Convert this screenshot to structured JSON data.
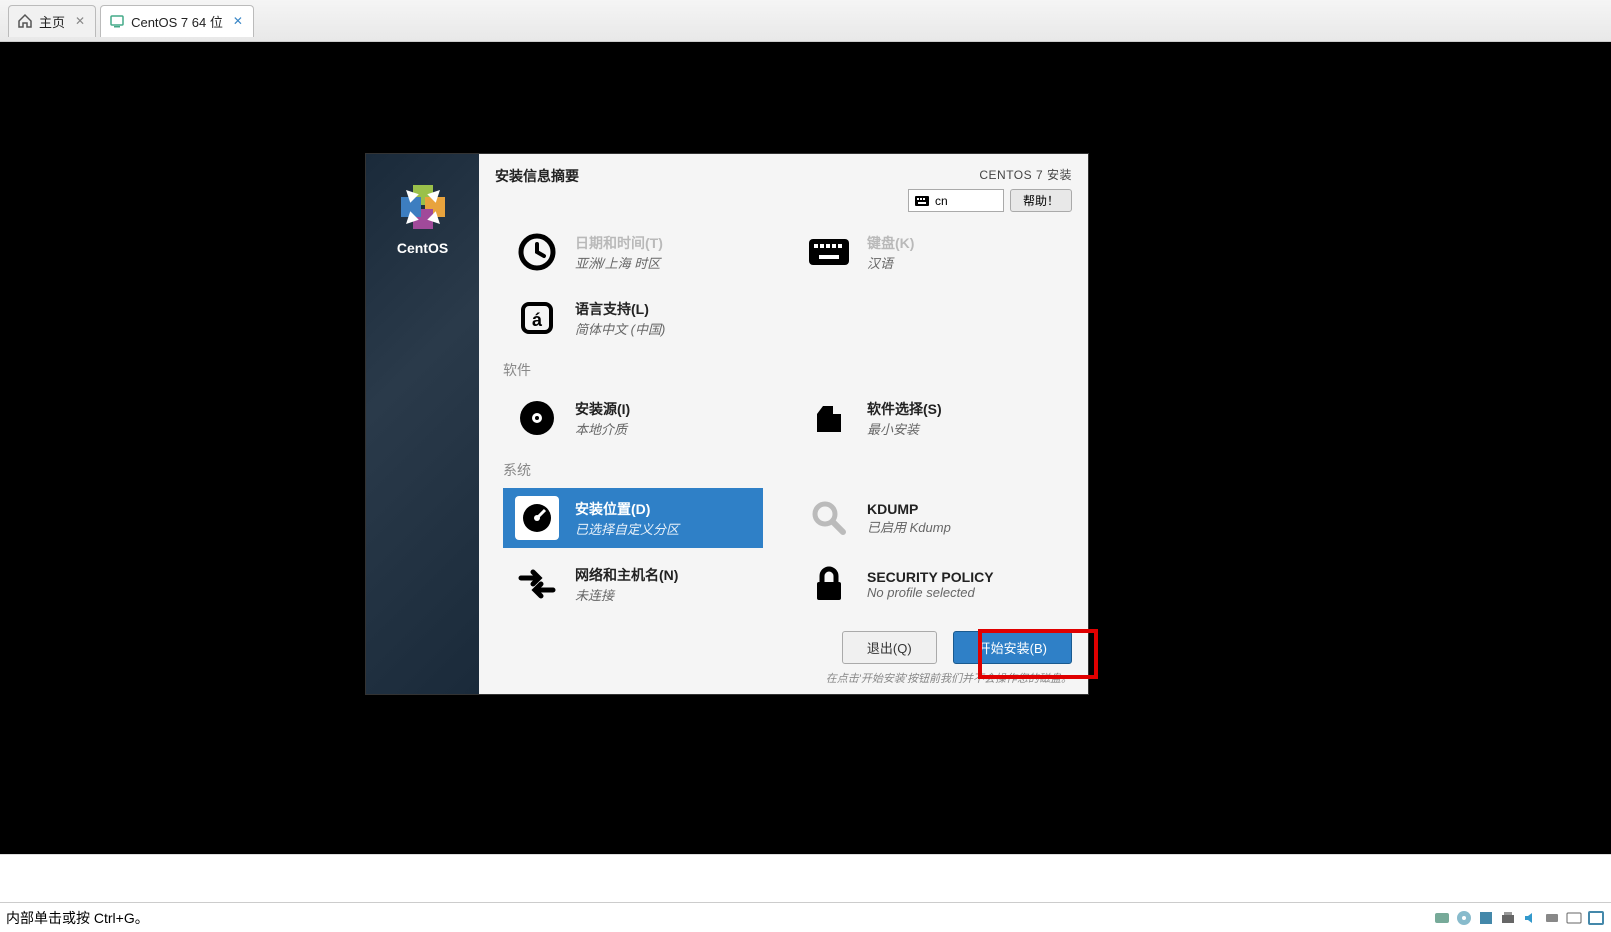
{
  "tabs": [
    {
      "label": "主页",
      "active": false
    },
    {
      "label": "CentOS 7 64 位",
      "active": true
    }
  ],
  "installer": {
    "brand": "CentOS",
    "header_title": "安装信息摘要",
    "header_brand": "CENTOS 7 安装",
    "lang_indicator": "cn",
    "help_label": "帮助！",
    "sections": {
      "localization_partial": {
        "datetime": {
          "title": "日期和时间(T)",
          "sub": "亚洲/上海 时区"
        },
        "keyboard": {
          "title": "键盘(K)",
          "sub": "汉语"
        },
        "language": {
          "title": "语言支持(L)",
          "sub": "简体中文 (中国)"
        }
      },
      "software": {
        "label": "软件",
        "source": {
          "title": "安装源(I)",
          "sub": "本地介质"
        },
        "selection": {
          "title": "软件选择(S)",
          "sub": "最小安装"
        }
      },
      "system": {
        "label": "系统",
        "destination": {
          "title": "安装位置(D)",
          "sub": "已选择自定义分区"
        },
        "kdump": {
          "title": "KDUMP",
          "sub": "已启用 Kdump"
        },
        "network": {
          "title": "网络和主机名(N)",
          "sub": "未连接"
        },
        "security": {
          "title": "SECURITY POLICY",
          "sub": "No profile selected"
        }
      }
    },
    "quit_label": "退出(Q)",
    "begin_label": "开始安装(B)",
    "footer_hint": "在点击'开始安装'按钮前我们并不会操作您的磁盘。"
  },
  "status_text": "内部单击或按 Ctrl+G。"
}
